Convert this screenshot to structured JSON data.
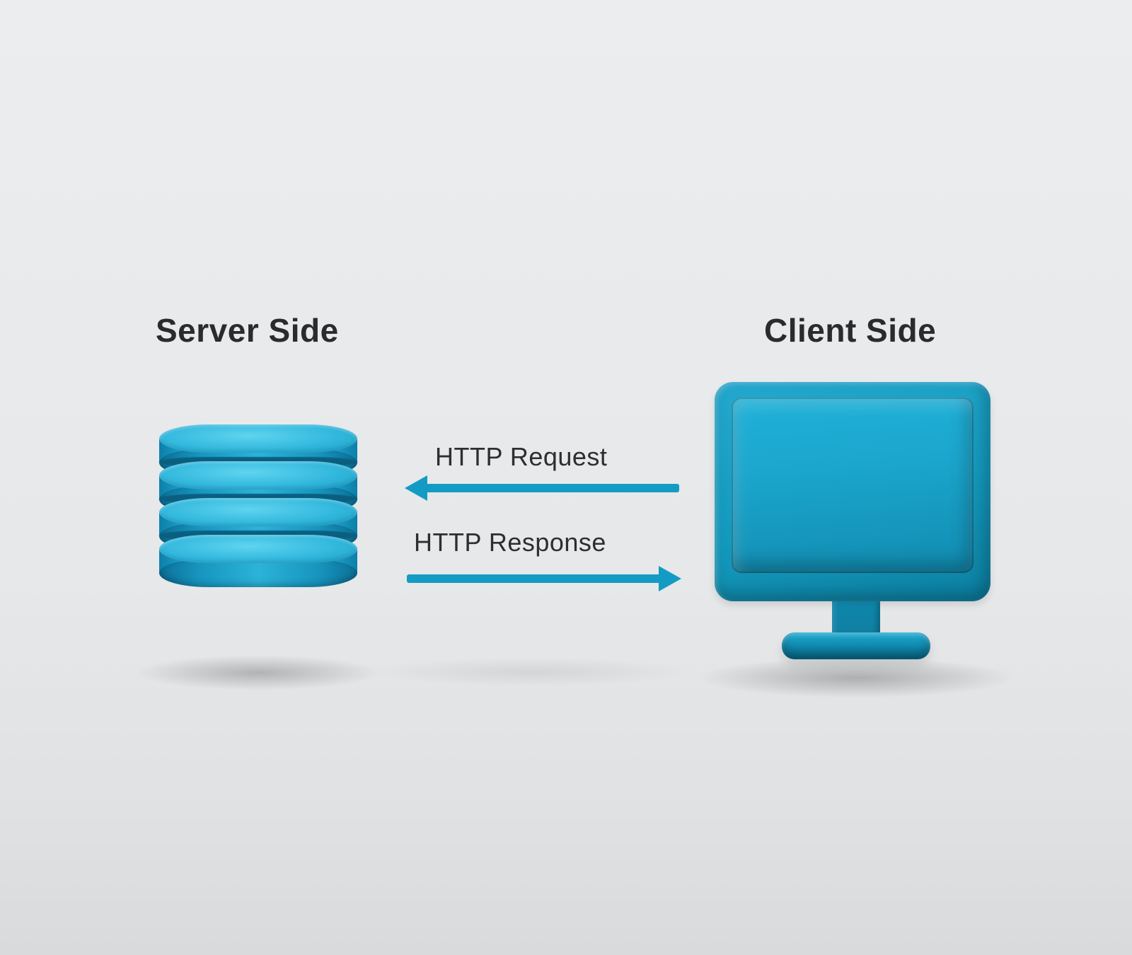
{
  "server": {
    "heading": "Server Side"
  },
  "client": {
    "heading": "Client Side"
  },
  "arrows": {
    "request": {
      "label": "HTTP Request"
    },
    "response": {
      "label": "HTTP Response"
    }
  },
  "colors": {
    "accent": "#149bc4",
    "text": "#2a2b2c"
  }
}
